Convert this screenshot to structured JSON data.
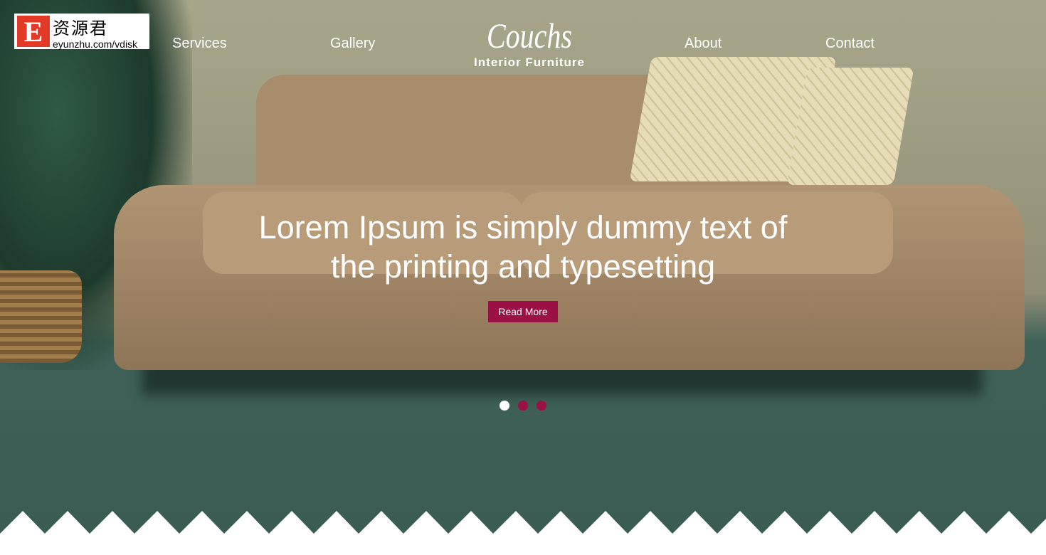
{
  "logo": {
    "letter": "E",
    "chinese": "资源君",
    "url": "eyunzhu.com/vdisk"
  },
  "nav": {
    "items": [
      "Services",
      "Gallery",
      "About",
      "Contact"
    ]
  },
  "brand": {
    "name": "Couchs",
    "tagline": "Interior Furniture"
  },
  "hero": {
    "headline": "Lorem Ipsum is simply dummy text of the printing and typesetting",
    "button": "Read More",
    "slides": 3,
    "active_slide": 1
  },
  "colors": {
    "accent": "#9b1045",
    "carpet": "#3a5c52"
  }
}
